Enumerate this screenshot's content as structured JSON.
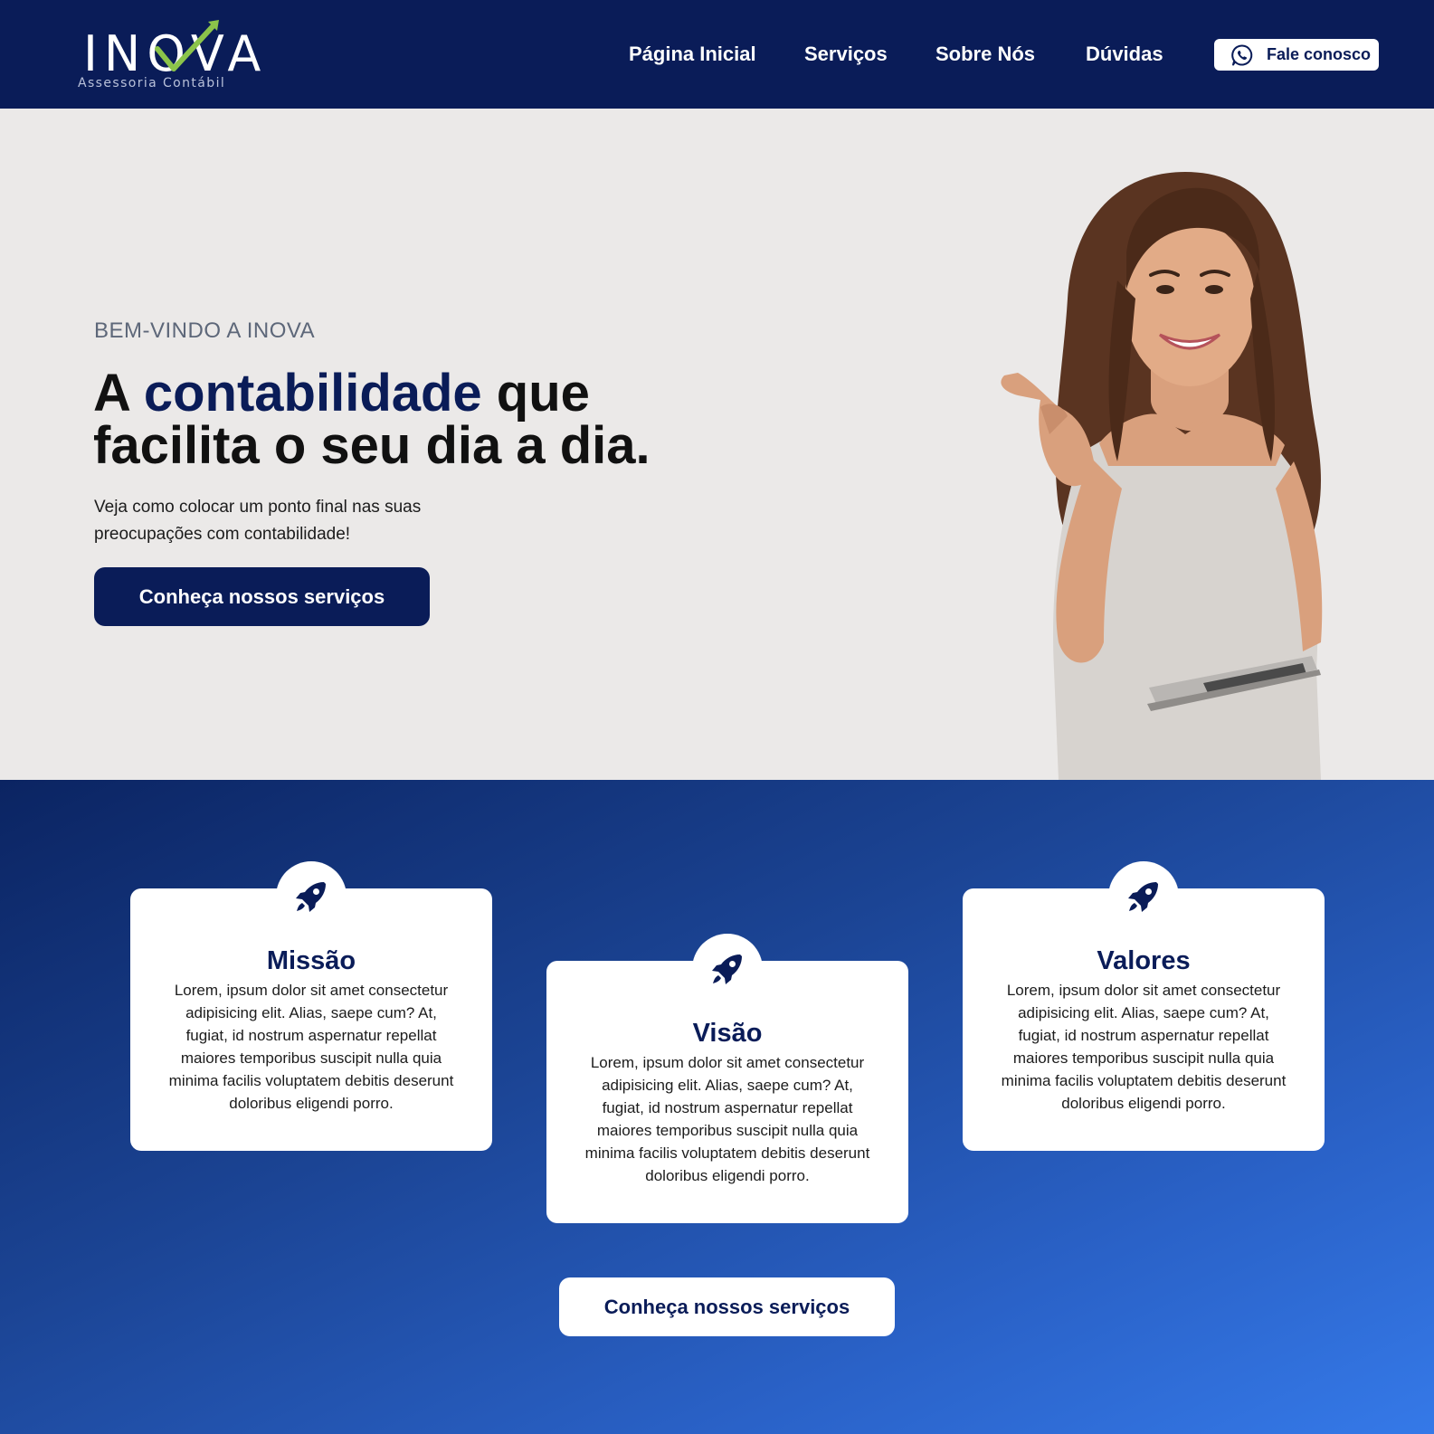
{
  "colors": {
    "navy": "#0a1c58",
    "hero_bg": "#ebe9e8",
    "accent_green": "#8bc34a",
    "gradient_start": "#0b2462",
    "gradient_end": "#3579e8",
    "white": "#ffffff"
  },
  "header": {
    "logo": {
      "text": "INOVA",
      "subtitle": "Assessoria Contábil",
      "icon": "checkmark-arrow-icon"
    },
    "nav": [
      {
        "label": "Página Inicial"
      },
      {
        "label": "Serviços"
      },
      {
        "label": "Sobre Nós"
      },
      {
        "label": "Dúvidas"
      }
    ],
    "contact_button": {
      "label": "Fale conosco",
      "icon": "whatsapp-icon"
    }
  },
  "hero": {
    "eyebrow": "BEM-VINDO A INOVA",
    "title_part1": "A ",
    "title_accent": "contabilidade",
    "title_part2": " que facilita o seu dia a dia.",
    "subtitle": "Veja como colocar um ponto final nas suas preocupações com contabilidade!",
    "cta_label": "Conheça nossos serviços",
    "image": "smiling-woman-thumbs-pointing-holding-laptop"
  },
  "values": {
    "cards": [
      {
        "icon": "rocket-icon",
        "title": "Missão",
        "text": "Lorem, ipsum dolor sit amet consectetur adipisicing elit. Alias, saepe cum? At, fugiat, id nostrum aspernatur repellat maiores temporibus suscipit nulla quia minima facilis voluptatem debitis deserunt doloribus eligendi porro."
      },
      {
        "icon": "rocket-icon",
        "title": "Visão",
        "text": "Lorem, ipsum dolor sit amet consectetur adipisicing elit. Alias, saepe cum? At, fugiat, id nostrum aspernatur repellat maiores temporibus suscipit nulla quia minima facilis voluptatem debitis deserunt doloribus eligendi porro."
      },
      {
        "icon": "rocket-icon",
        "title": "Valores",
        "text": "Lorem, ipsum dolor sit amet consectetur adipisicing elit. Alias, saepe cum? At, fugiat, id nostrum aspernatur repellat maiores temporibus suscipit nulla quia minima facilis voluptatem debitis deserunt doloribus eligendi porro."
      }
    ],
    "cta_label": "Conheça nossos serviços"
  }
}
